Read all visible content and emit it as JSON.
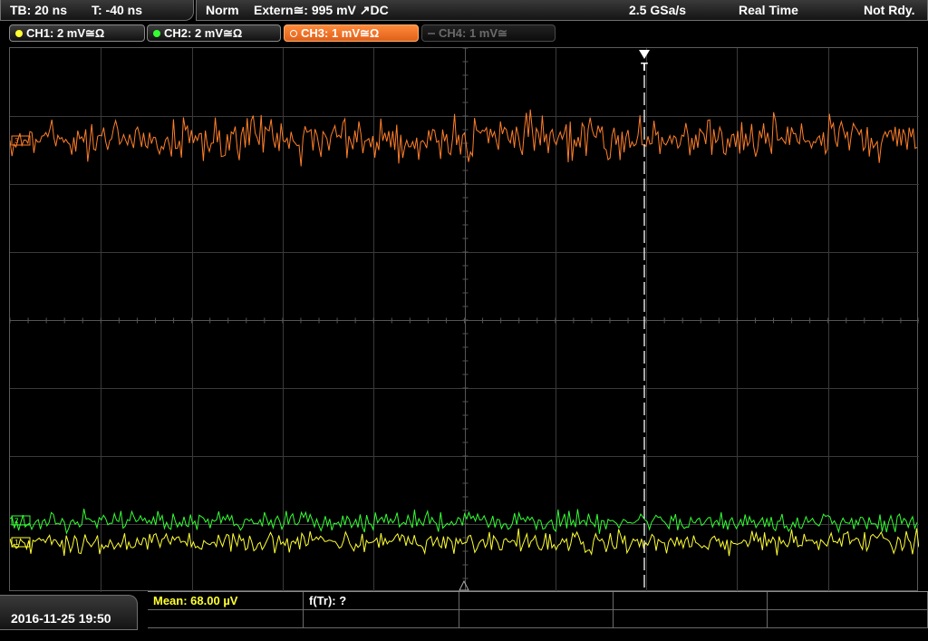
{
  "timebase": {
    "tb": "TB: 20 ns",
    "t": "T: -40 ns"
  },
  "trigger_bar": {
    "mode": "Norm",
    "source": "Extern≅: 995 mV ↗DC",
    "sample_rate": "2.5 GSa/s",
    "acq_mode": "Real Time",
    "status": "Not Rdy."
  },
  "channels": [
    {
      "label": "CH1: 2 mV≅Ω",
      "color": "#ffff33",
      "active": true
    },
    {
      "label": "CH2: 2 mV≅Ω",
      "color": "#33ff33",
      "active": true
    },
    {
      "label": "CH3: 1 mV≅Ω",
      "color": "#ff7f2a",
      "active": true
    },
    {
      "label": "CH4: 1 mV≅",
      "color": "#6a6a6a",
      "active": false
    }
  ],
  "trigger_marker": "T",
  "footer": {
    "datetime": "2016-11-25 19:50",
    "measurements": [
      {
        "label": "Mean: 68.00 µV",
        "color": "#ffff33"
      },
      {
        "label": "f(Tr): ?",
        "color": "#ffffff"
      }
    ]
  },
  "colors": {
    "ch1": "#ffff33",
    "ch2": "#33ff33",
    "ch3": "#ff7f2a",
    "grid": "#3a3a3a"
  }
}
